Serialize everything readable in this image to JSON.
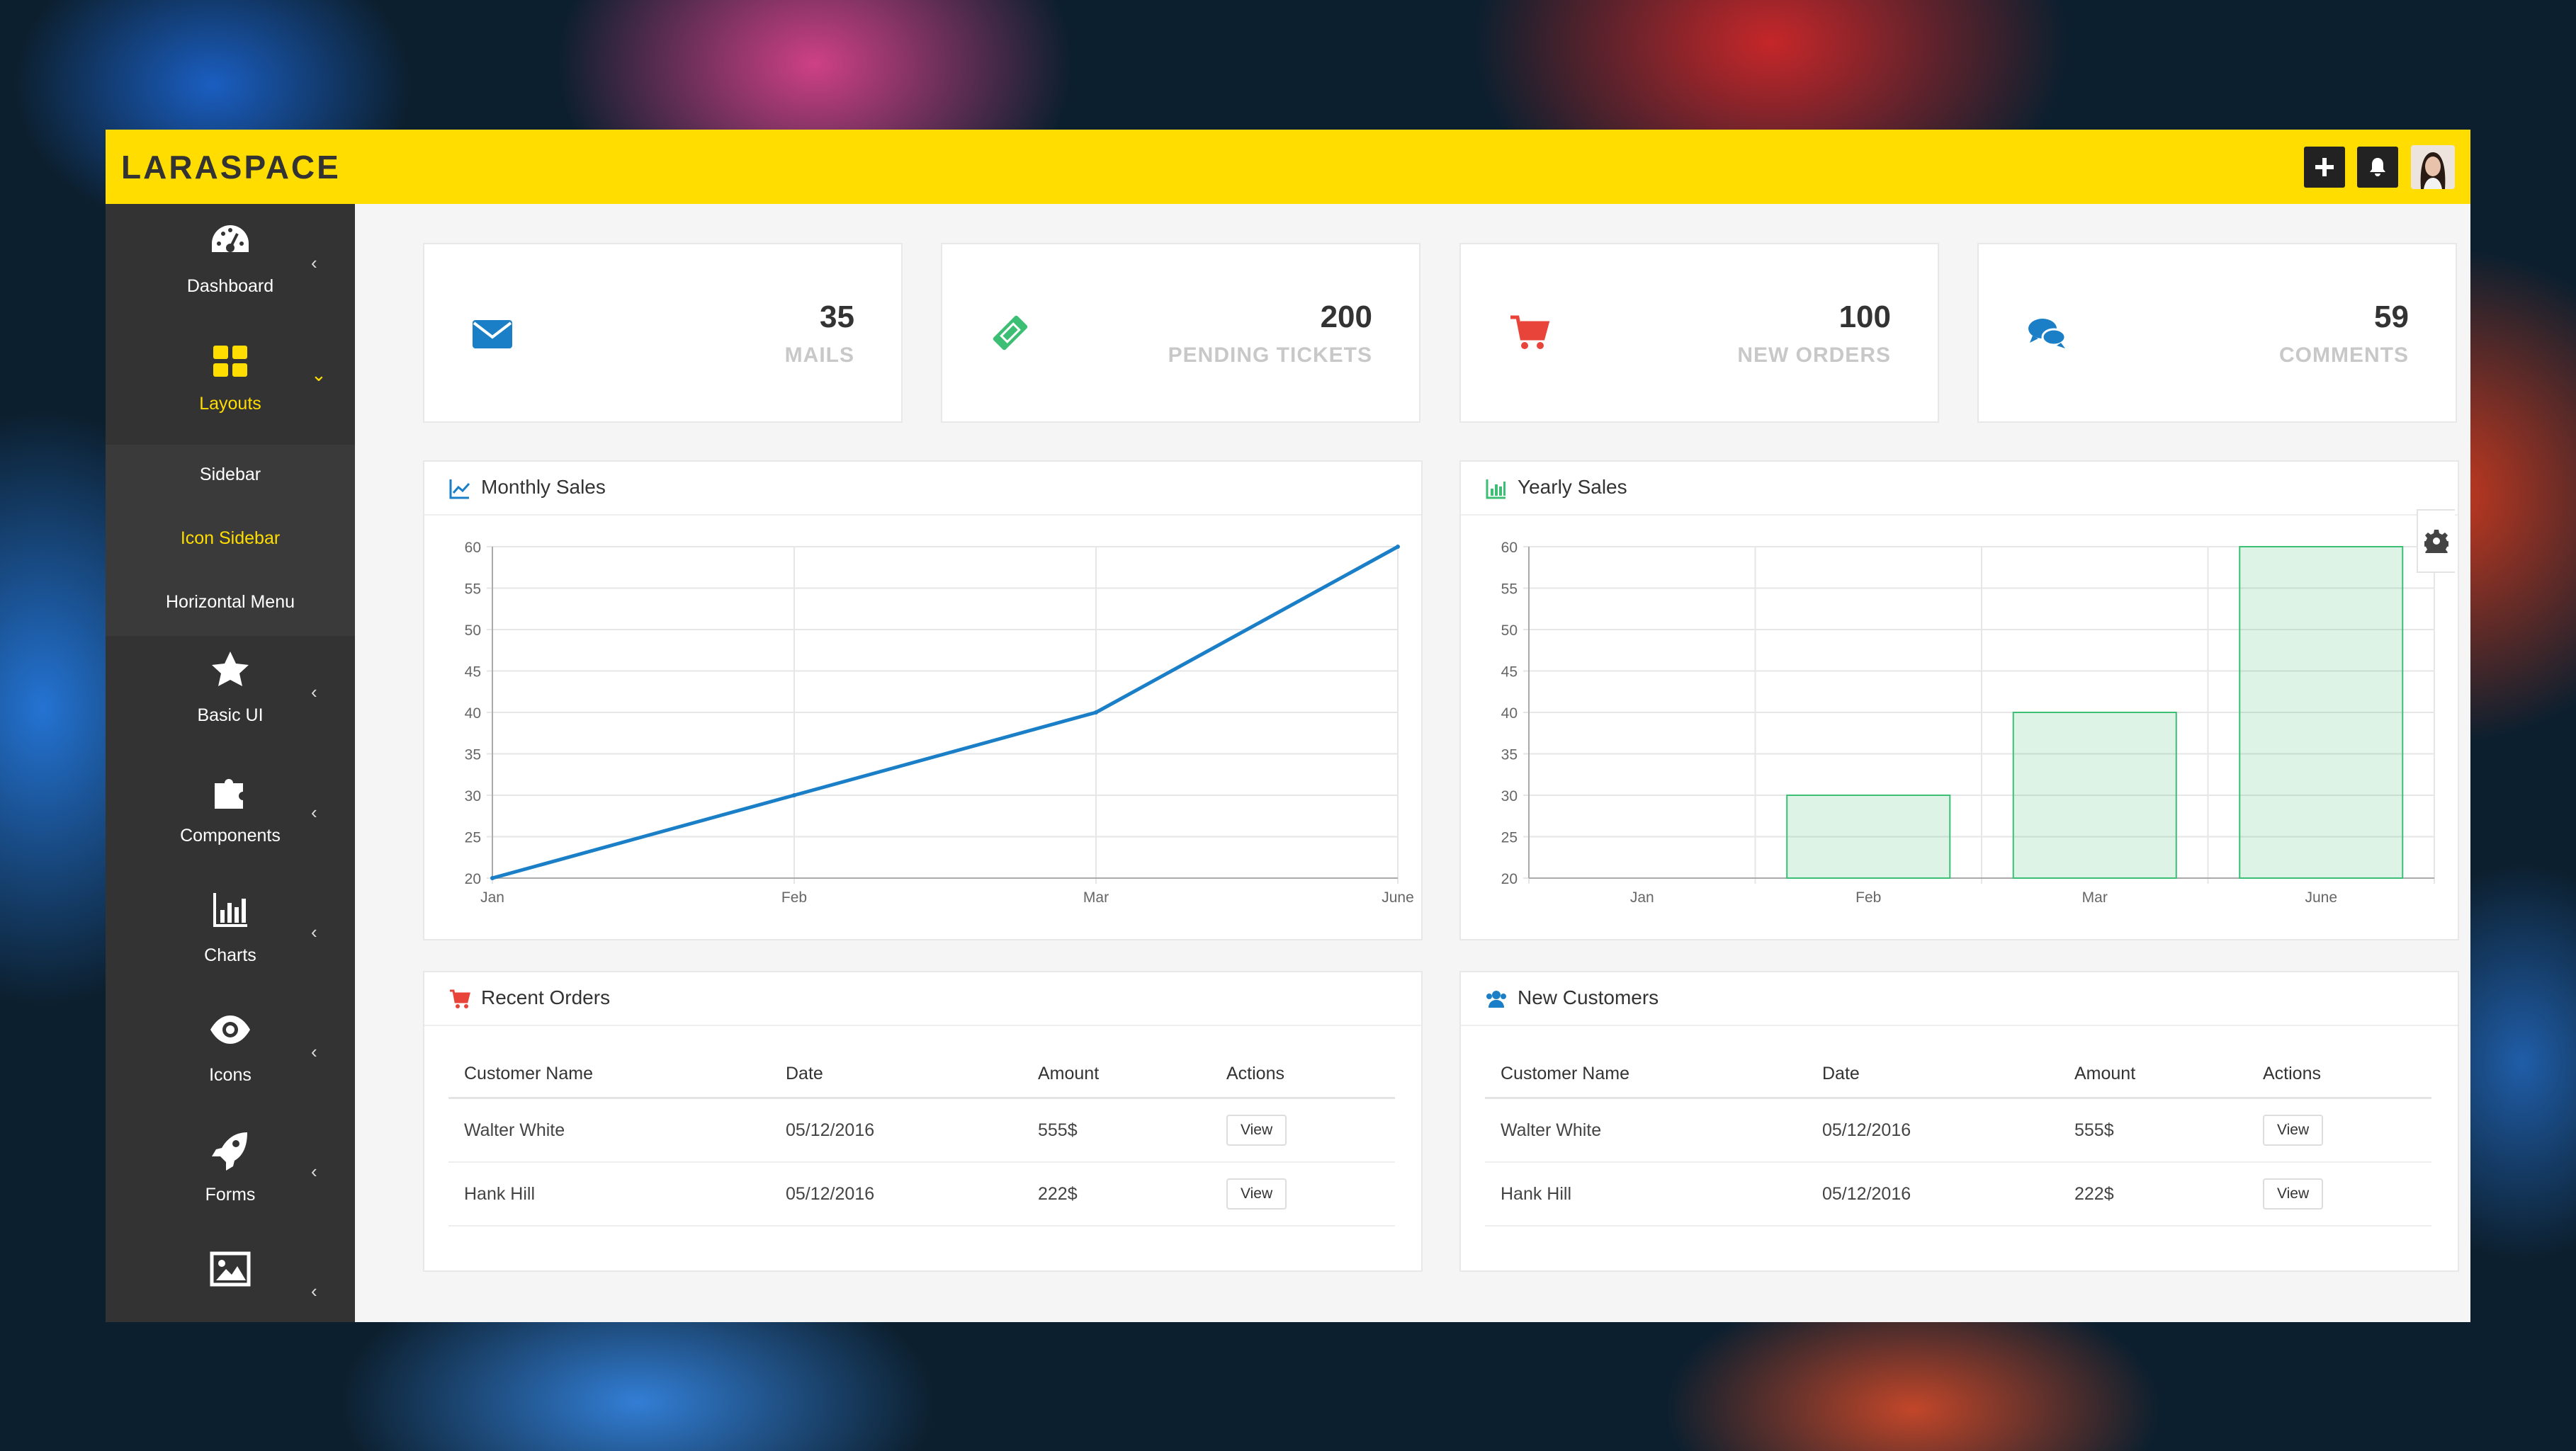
{
  "app": {
    "brand": "LARASPACE"
  },
  "sidebar": {
    "items": [
      {
        "label": "Dashboard",
        "icon": "dashboard-icon"
      },
      {
        "label": "Layouts",
        "icon": "layouts-icon"
      },
      {
        "label": "Basic UI",
        "icon": "star-icon"
      },
      {
        "label": "Components",
        "icon": "puzzle-icon"
      },
      {
        "label": "Charts",
        "icon": "bar-chart-icon"
      },
      {
        "label": "Icons",
        "icon": "eye-icon"
      },
      {
        "label": "Forms",
        "icon": "rocket-icon"
      },
      {
        "label": "",
        "icon": "image-icon"
      }
    ],
    "layouts_sub": [
      "Sidebar",
      "Icon Sidebar",
      "Horizontal Menu"
    ],
    "active_color": "#ffdd00"
  },
  "stats": [
    {
      "value": "35",
      "label": "MAILS",
      "icon": "envelope-icon",
      "color": "#1a7fc7"
    },
    {
      "value": "200",
      "label": "PENDING TICKETS",
      "icon": "ticket-icon",
      "color": "#3cbf74"
    },
    {
      "value": "100",
      "label": "NEW ORDERS",
      "icon": "cart-icon",
      "color": "#e8443a"
    },
    {
      "value": "59",
      "label": "COMMENTS",
      "icon": "comments-icon",
      "color": "#1a7fc7"
    }
  ],
  "panels": {
    "monthly_title": "Monthly Sales",
    "yearly_title": "Yearly Sales",
    "orders_title": "Recent Orders",
    "customers_title": "New Customers"
  },
  "chart_data": [
    {
      "type": "line",
      "title": "Monthly Sales",
      "categories": [
        "Jan",
        "Feb",
        "Mar",
        "June"
      ],
      "values": [
        20,
        30,
        40,
        60
      ],
      "ylim": [
        20,
        60
      ],
      "yticks": [
        20,
        25,
        30,
        35,
        40,
        45,
        50,
        55,
        60
      ],
      "grid": true,
      "color": "#1a7fc7"
    },
    {
      "type": "bar",
      "title": "Yearly Sales",
      "categories": [
        "Jan",
        "Feb",
        "Mar",
        "June"
      ],
      "values": [
        20,
        30,
        40,
        60
      ],
      "ylim": [
        20,
        60
      ],
      "yticks": [
        20,
        25,
        30,
        35,
        40,
        45,
        50,
        55,
        60
      ],
      "grid": true,
      "color": "#3cbf74"
    }
  ],
  "tables": {
    "headers": [
      "Customer Name",
      "Date",
      "Amount",
      "Actions"
    ],
    "rows": [
      {
        "name": "Walter White",
        "date": "05/12/2016",
        "amount": "555$",
        "action": "View"
      },
      {
        "name": "Hank Hill",
        "date": "05/12/2016",
        "amount": "222$",
        "action": "View"
      }
    ]
  }
}
